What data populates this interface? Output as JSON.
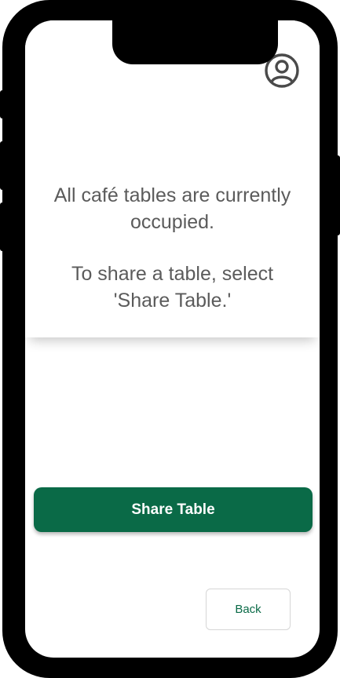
{
  "header": {
    "profile_icon": "user-circle-icon"
  },
  "message": {
    "line1": "All café tables are currently occupied.",
    "line2": "To share a table, select 'Share Table.'"
  },
  "actions": {
    "share_label": "Share Table",
    "back_label": "Back"
  },
  "colors": {
    "primary": "#0a6a47",
    "text": "#5b5b5b",
    "device_frame": "#000000"
  }
}
